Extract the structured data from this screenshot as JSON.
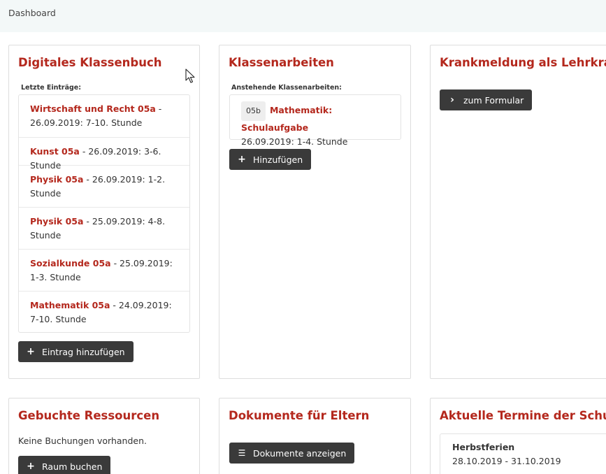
{
  "breadcrumb": "Dashboard",
  "klassenbuch": {
    "title": "Digitales Klassenbuch",
    "sublabel": "Letzte Einträge:",
    "entries": [
      {
        "subject": "Wirtschaft und Recht 05a",
        "detail": " - 26.09.2019: 7-10. Stunde"
      },
      {
        "subject": "Kunst 05a",
        "detail": " - 26.09.2019: 3-6. Stunde"
      },
      {
        "subject": "Physik 05a",
        "detail": " - 26.09.2019: 1-2. Stunde"
      },
      {
        "subject": "Physik 05a",
        "detail": " - 25.09.2019: 4-8. Stunde"
      },
      {
        "subject": "Sozialkunde 05a",
        "detail": " - 25.09.2019: 1-3. Stunde"
      },
      {
        "subject": "Mathematik 05a",
        "detail": " - 24.09.2019: 7-10. Stunde"
      }
    ],
    "add_button": "Eintrag hinzufügen"
  },
  "klassenarbeiten": {
    "title": "Klassenarbeiten",
    "sublabel": "Anstehende Klassenarbeiten:",
    "item": {
      "class": "05b",
      "subject": "Mathematik: Schulaufgabe",
      "detail": "26.09.2019: 1-4. Stunde"
    },
    "add_button": "Hinzufügen"
  },
  "krankmeldung": {
    "title": "Krankmeldung als Lehrkraft",
    "button": "zum Formular"
  },
  "ressourcen": {
    "title": "Gebuchte Ressourcen",
    "empty_text": "Keine Buchungen vorhanden.",
    "button": "Raum buchen"
  },
  "dokumente": {
    "title": "Dokumente für Eltern",
    "button": "Dokumente anzeigen"
  },
  "termine": {
    "title": "Aktuelle Termine der Schule",
    "event": {
      "name": "Herbstferien",
      "dates": "28.10.2019 - 31.10.2019"
    }
  },
  "colors": {
    "accent": "#b4281d",
    "button": "#3a3a3a",
    "topbar": "#f3f8f8"
  },
  "icons": {
    "plus": "plus-icon",
    "chevron": "chevron-right-icon",
    "list": "list-icon"
  }
}
